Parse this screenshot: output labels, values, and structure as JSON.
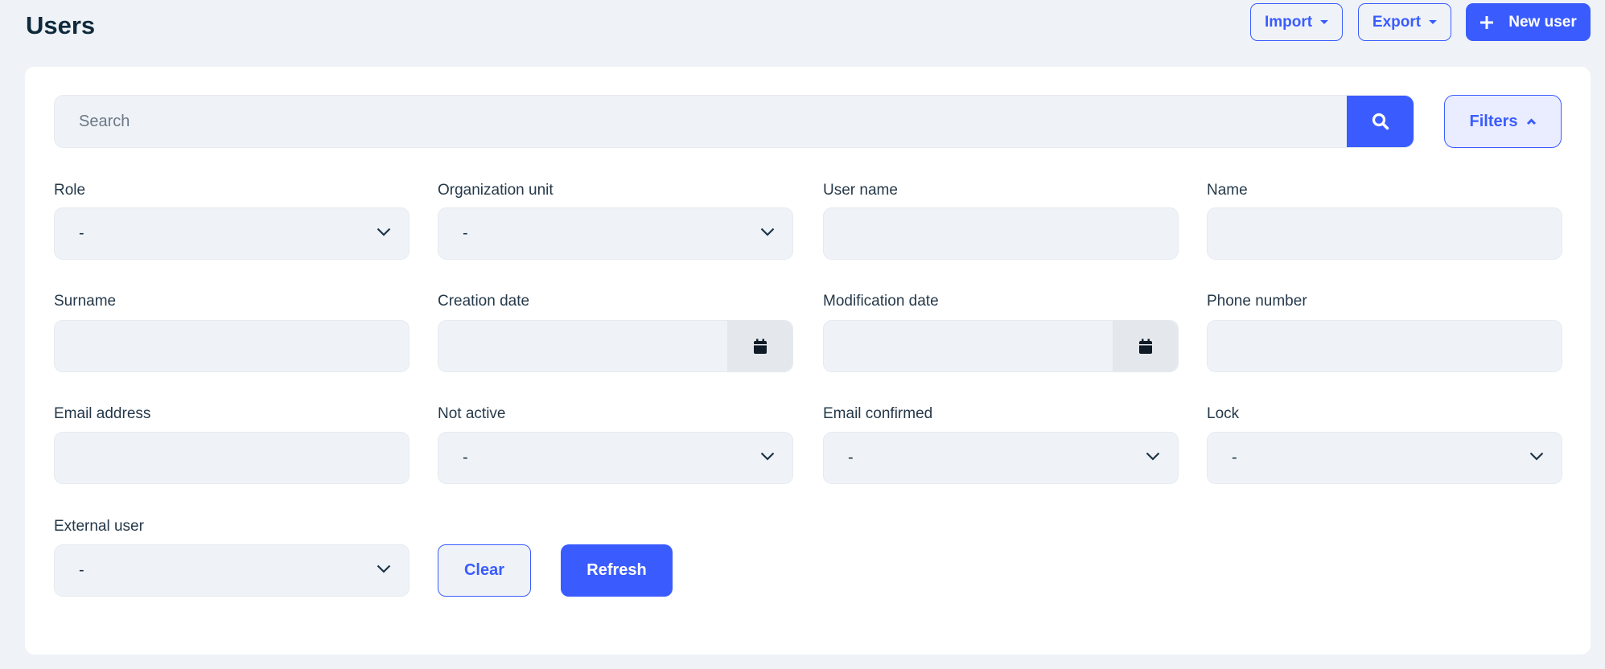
{
  "header": {
    "title": "Users",
    "import_label": "Import",
    "export_label": "Export",
    "new_user_label": "New user"
  },
  "search": {
    "placeholder": "Search",
    "filters_label": "Filters"
  },
  "filters": [
    {
      "label": "Role",
      "type": "select",
      "value": "-"
    },
    {
      "label": "Organization unit",
      "type": "select",
      "value": "-"
    },
    {
      "label": "User name",
      "type": "text",
      "value": ""
    },
    {
      "label": "Name",
      "type": "text",
      "value": ""
    },
    {
      "label": "Surname",
      "type": "text",
      "value": ""
    },
    {
      "label": "Creation date",
      "type": "date",
      "value": ""
    },
    {
      "label": "Modification date",
      "type": "date",
      "value": ""
    },
    {
      "label": "Phone number",
      "type": "text",
      "value": ""
    },
    {
      "label": "Email address",
      "type": "text",
      "value": ""
    },
    {
      "label": "Not active",
      "type": "select",
      "value": "-"
    },
    {
      "label": "Email confirmed",
      "type": "select",
      "value": "-"
    },
    {
      "label": "Lock",
      "type": "select",
      "value": "-"
    },
    {
      "label": "External user",
      "type": "select",
      "value": "-"
    }
  ],
  "actions": {
    "clear_label": "Clear",
    "refresh_label": "Refresh"
  },
  "colors": {
    "accent": "#3a5cff",
    "background": "#eff3f7"
  }
}
